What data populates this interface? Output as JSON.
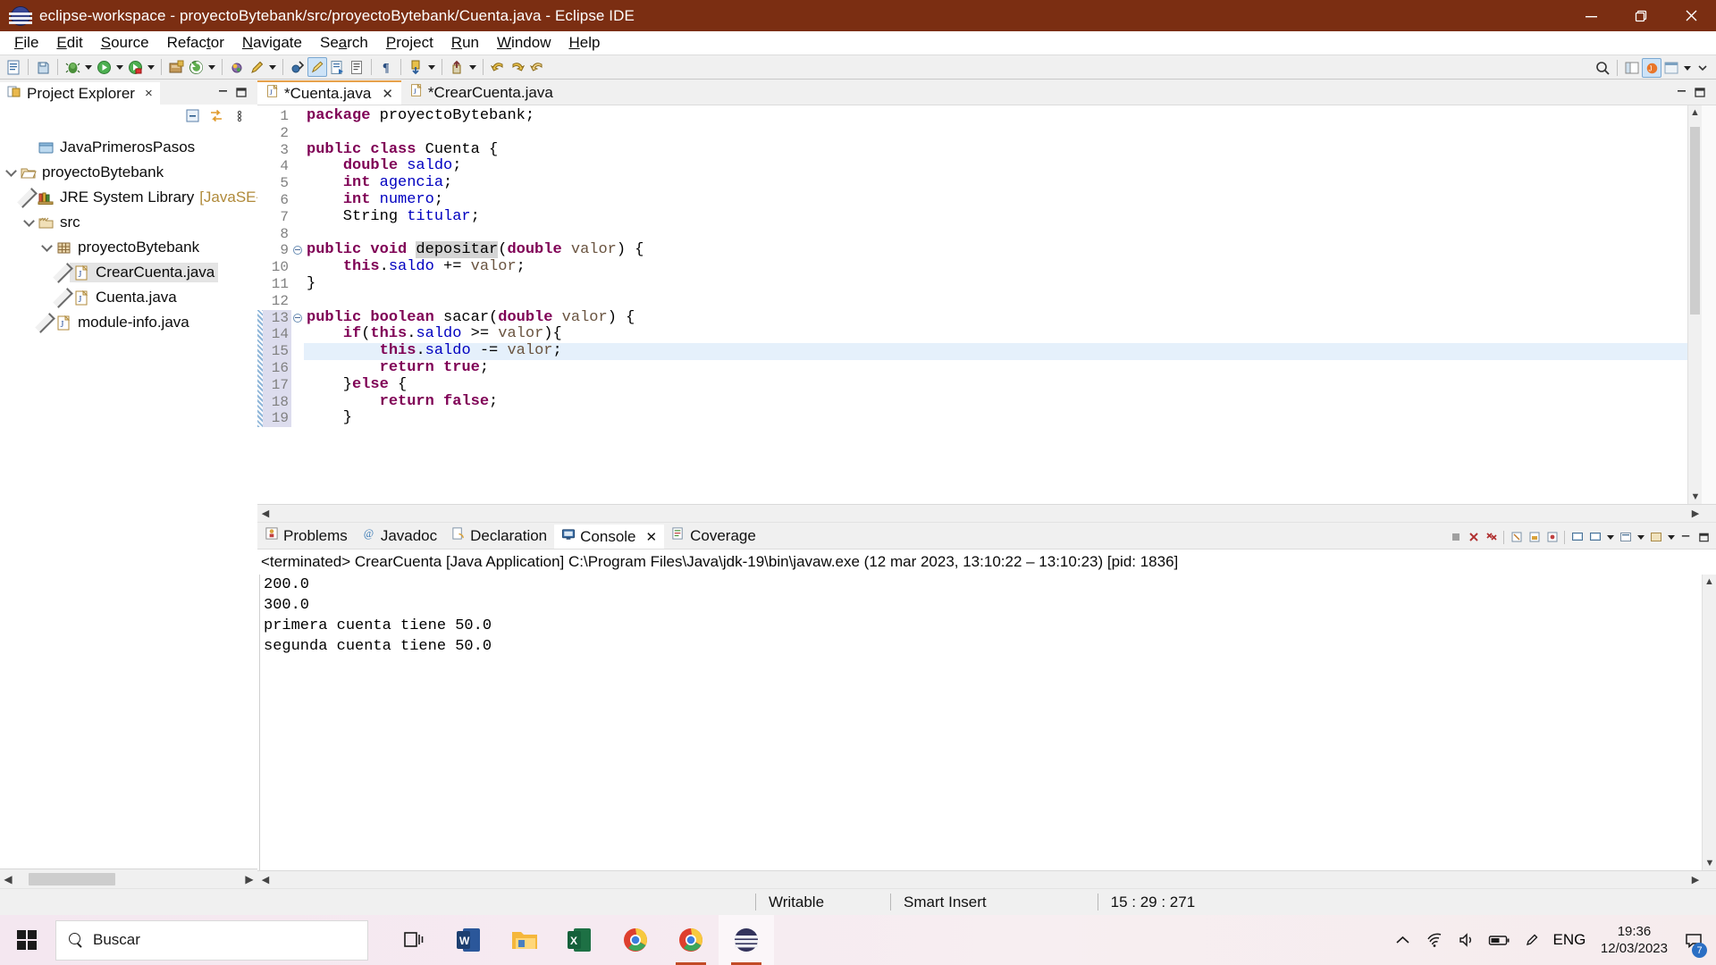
{
  "window": {
    "title": "eclipse-workspace - proyectoBytebank/src/proyectoBytebank/Cuenta.java - Eclipse IDE",
    "icon": "eclipse-icon",
    "minimize_label": "Minimize",
    "maximize_label": "Restore",
    "close_label": "Close",
    "titlebar_color": "#7b2e12"
  },
  "menubar": {
    "items": [
      {
        "label": "File",
        "mnemonic": "F"
      },
      {
        "label": "Edit",
        "mnemonic": "E"
      },
      {
        "label": "Source",
        "mnemonic": "S"
      },
      {
        "label": "Refactor",
        "mnemonic": "t"
      },
      {
        "label": "Navigate",
        "mnemonic": "N"
      },
      {
        "label": "Search",
        "mnemonic": "a"
      },
      {
        "label": "Project",
        "mnemonic": "P"
      },
      {
        "label": "Run",
        "mnemonic": "R"
      },
      {
        "label": "Window",
        "mnemonic": "W"
      },
      {
        "label": "Help",
        "mnemonic": "H"
      }
    ]
  },
  "toolbar": {
    "buttons": [
      "new-wizard-icon",
      "save-icon",
      "debug-icon",
      "run-icon",
      "coverage-icon",
      "new-java-project-icon",
      "open-type-icon",
      "search-icon",
      "edit-icon",
      "skip-breakpoints-icon",
      "java-perspective-icon",
      "open-task-icon",
      "toggle-markoccurrences-icon",
      "pilcrow-icon",
      "next-annotation-icon",
      "previous-annotation-icon",
      "back-icon",
      "forward-icon"
    ],
    "right_buttons": [
      "quick-access-search-icon",
      "open-perspective-icon",
      "java-perspective-icon",
      "java-ee-perspective-icon"
    ]
  },
  "project_explorer": {
    "tab_label": "Project Explorer",
    "tab_icon": "project-explorer-icon",
    "close_label": "×",
    "tools": [
      "collapse-all-icon",
      "link-with-editor-icon"
    ],
    "tree": [
      {
        "label": "JavaPrimerosPasos",
        "icon": "project-closed-icon",
        "indent": 1,
        "twisty": "none",
        "selected": false
      },
      {
        "label": "proyectoBytebank",
        "icon": "project-open-icon",
        "indent": 0,
        "twisty": "down",
        "selected": false
      },
      {
        "label": "JRE System Library",
        "suffix": "[JavaSE-",
        "icon": "library-icon",
        "indent": 1,
        "twisty": "right",
        "selected": false
      },
      {
        "label": "src",
        "icon": "source-folder-icon",
        "indent": 1,
        "twisty": "down",
        "selected": false
      },
      {
        "label": "proyectoBytebank",
        "icon": "package-icon",
        "indent": 2,
        "twisty": "down",
        "selected": false
      },
      {
        "label": "CrearCuenta.java",
        "icon": "java-file-icon",
        "indent": 3,
        "twisty": "right",
        "selected": true
      },
      {
        "label": "Cuenta.java",
        "icon": "java-file-icon",
        "indent": 3,
        "twisty": "right",
        "selected": false
      },
      {
        "label": "module-info.java",
        "icon": "java-file-icon",
        "indent": 2,
        "twisty": "right",
        "selected": false
      }
    ],
    "hscroll": {
      "left_arrow": "◀",
      "right_arrow": "▶"
    }
  },
  "editor": {
    "tabs": [
      {
        "label": "*Cuenta.java",
        "icon": "java-file-icon",
        "active": true,
        "closable": true
      },
      {
        "label": "*CrearCuenta.java",
        "icon": "java-file-icon",
        "active": false,
        "closable": false
      }
    ],
    "lines": [
      {
        "n": 1,
        "fold": "",
        "changed": false,
        "current": false,
        "tokens": [
          {
            "t": "package",
            "c": "kw"
          },
          {
            "t": " proyectoBytebank;",
            "c": "plain"
          }
        ]
      },
      {
        "n": 2,
        "fold": "",
        "changed": false,
        "current": false,
        "tokens": []
      },
      {
        "n": 3,
        "fold": "",
        "changed": false,
        "current": false,
        "tokens": [
          {
            "t": "public class",
            "c": "kw"
          },
          {
            "t": " Cuenta {",
            "c": "plain"
          }
        ]
      },
      {
        "n": 4,
        "fold": "",
        "changed": false,
        "current": false,
        "tokens": [
          {
            "t": "    ",
            "c": "plain"
          },
          {
            "t": "double",
            "c": "kw"
          },
          {
            "t": " ",
            "c": "plain"
          },
          {
            "t": "saldo",
            "c": "fld"
          },
          {
            "t": ";",
            "c": "plain"
          }
        ]
      },
      {
        "n": 5,
        "fold": "",
        "changed": false,
        "current": false,
        "tokens": [
          {
            "t": "    ",
            "c": "plain"
          },
          {
            "t": "int",
            "c": "kw"
          },
          {
            "t": " ",
            "c": "plain"
          },
          {
            "t": "agencia",
            "c": "fld"
          },
          {
            "t": ";",
            "c": "plain"
          }
        ]
      },
      {
        "n": 6,
        "fold": "",
        "changed": false,
        "current": false,
        "tokens": [
          {
            "t": "    ",
            "c": "plain"
          },
          {
            "t": "int",
            "c": "kw"
          },
          {
            "t": " ",
            "c": "plain"
          },
          {
            "t": "numero",
            "c": "fld"
          },
          {
            "t": ";",
            "c": "plain"
          }
        ]
      },
      {
        "n": 7,
        "fold": "",
        "changed": false,
        "current": false,
        "tokens": [
          {
            "t": "    String ",
            "c": "plain"
          },
          {
            "t": "titular",
            "c": "fld"
          },
          {
            "t": ";",
            "c": "plain"
          }
        ]
      },
      {
        "n": 8,
        "fold": "",
        "changed": false,
        "current": false,
        "tokens": []
      },
      {
        "n": 9,
        "fold": "minus",
        "changed": false,
        "current": false,
        "tokens": [
          {
            "t": "public void",
            "c": "kw"
          },
          {
            "t": " ",
            "c": "plain"
          },
          {
            "t": "depositar",
            "c": "occ"
          },
          {
            "t": "(",
            "c": "plain"
          },
          {
            "t": "double",
            "c": "kw"
          },
          {
            "t": " ",
            "c": "plain"
          },
          {
            "t": "valor",
            "c": "arg"
          },
          {
            "t": ") {",
            "c": "plain"
          }
        ]
      },
      {
        "n": 10,
        "fold": "",
        "changed": false,
        "current": false,
        "tokens": [
          {
            "t": "    ",
            "c": "plain"
          },
          {
            "t": "this",
            "c": "kw"
          },
          {
            "t": ".",
            "c": "plain"
          },
          {
            "t": "saldo",
            "c": "fld"
          },
          {
            "t": " += ",
            "c": "plain"
          },
          {
            "t": "valor",
            "c": "arg"
          },
          {
            "t": ";",
            "c": "plain"
          }
        ]
      },
      {
        "n": 11,
        "fold": "",
        "changed": false,
        "current": false,
        "tokens": [
          {
            "t": "}",
            "c": "plain"
          }
        ]
      },
      {
        "n": 12,
        "fold": "",
        "changed": false,
        "current": false,
        "tokens": []
      },
      {
        "n": 13,
        "fold": "minus",
        "changed": true,
        "current": false,
        "tokens": [
          {
            "t": "public boolean",
            "c": "kw"
          },
          {
            "t": " sacar(",
            "c": "plain"
          },
          {
            "t": "double",
            "c": "kw"
          },
          {
            "t": " ",
            "c": "plain"
          },
          {
            "t": "valor",
            "c": "arg"
          },
          {
            "t": ") {",
            "c": "plain"
          }
        ]
      },
      {
        "n": 14,
        "fold": "",
        "changed": true,
        "current": false,
        "tokens": [
          {
            "t": "    ",
            "c": "plain"
          },
          {
            "t": "if",
            "c": "kw"
          },
          {
            "t": "(",
            "c": "plain"
          },
          {
            "t": "this",
            "c": "kw"
          },
          {
            "t": ".",
            "c": "plain"
          },
          {
            "t": "saldo",
            "c": "fld"
          },
          {
            "t": " >= ",
            "c": "plain"
          },
          {
            "t": "valor",
            "c": "arg"
          },
          {
            "t": "){",
            "c": "plain"
          }
        ]
      },
      {
        "n": 15,
        "fold": "",
        "changed": true,
        "current": true,
        "tokens": [
          {
            "t": "        ",
            "c": "plain"
          },
          {
            "t": "this",
            "c": "kw"
          },
          {
            "t": ".",
            "c": "plain"
          },
          {
            "t": "saldo",
            "c": "fld"
          },
          {
            "t": " -= ",
            "c": "plain"
          },
          {
            "t": "valor",
            "c": "arg"
          },
          {
            "t": ";",
            "c": "plain"
          }
        ]
      },
      {
        "n": 16,
        "fold": "",
        "changed": true,
        "current": false,
        "tokens": [
          {
            "t": "        ",
            "c": "plain"
          },
          {
            "t": "return true",
            "c": "kw"
          },
          {
            "t": ";",
            "c": "plain"
          }
        ]
      },
      {
        "n": 17,
        "fold": "",
        "changed": true,
        "current": false,
        "tokens": [
          {
            "t": "    }",
            "c": "plain"
          },
          {
            "t": "else",
            "c": "kw"
          },
          {
            "t": " {",
            "c": "plain"
          }
        ]
      },
      {
        "n": 18,
        "fold": "",
        "changed": true,
        "current": false,
        "tokens": [
          {
            "t": "        ",
            "c": "plain"
          },
          {
            "t": "return false",
            "c": "kw"
          },
          {
            "t": ";",
            "c": "plain"
          }
        ]
      },
      {
        "n": 19,
        "fold": "",
        "changed": true,
        "current": false,
        "tokens": [
          {
            "t": "    }",
            "c": "plain"
          }
        ]
      }
    ]
  },
  "bottom_panel": {
    "tabs": [
      {
        "label": "Problems",
        "icon": "problems-icon",
        "active": false,
        "closable": false
      },
      {
        "label": "Javadoc",
        "icon": "javadoc-icon",
        "active": false,
        "closable": false
      },
      {
        "label": "Declaration",
        "icon": "declaration-icon",
        "active": false,
        "closable": false
      },
      {
        "label": "Console",
        "icon": "console-icon",
        "active": true,
        "closable": true
      },
      {
        "label": "Coverage",
        "icon": "coverage-icon",
        "active": false,
        "closable": false
      }
    ],
    "tools": [
      "terminate-icon",
      "remove-launch-icon",
      "remove-all-launches-icon",
      "clear-console-icon",
      "scroll-lock-icon",
      "pin-console-icon",
      "show-console-on-output-icon",
      "display-selected-console-icon",
      "open-console-icon",
      "new-console-view-icon",
      "minimize-icon",
      "maximize-icon"
    ],
    "console": {
      "header": "<terminated> CrearCuenta [Java Application] C:\\Program Files\\Java\\jdk-19\\bin\\javaw.exe  (12 mar 2023, 13:10:22 – 13:10:23) [pid: 1836]",
      "output": "200.0\n300.0\nprimera cuenta tiene 50.0\nsegunda cuenta tiene 50.0"
    }
  },
  "statusbar": {
    "writable": "Writable",
    "insert_mode": "Smart Insert",
    "position": "15 : 29 : 271"
  },
  "taskbar": {
    "start_label": "Start",
    "search_placeholder": "Buscar",
    "search_icon": "search-icon",
    "task_view_label": "Task View",
    "apps": [
      {
        "name": "word-icon",
        "label": "Word",
        "running": false,
        "active": false
      },
      {
        "name": "file-explorer-icon",
        "label": "File Explorer",
        "running": false,
        "active": false
      },
      {
        "name": "excel-icon",
        "label": "Excel",
        "running": false,
        "active": false
      },
      {
        "name": "chrome-icon",
        "label": "Google Chrome",
        "running": false,
        "active": false
      },
      {
        "name": "chrome-icon",
        "label": "Google Chrome",
        "running": true,
        "active": false
      },
      {
        "name": "eclipse-icon",
        "label": "Eclipse IDE",
        "running": true,
        "active": true
      }
    ],
    "tray": {
      "overflow_icon": "chevron-up-icon",
      "network_icon": "wifi-icon",
      "volume_icon": "speaker-icon",
      "battery_icon": "battery-icon",
      "pen_icon": "pen-icon",
      "language": "ENG",
      "time": "19:36",
      "date": "12/03/2023",
      "notification_count": "7"
    }
  }
}
